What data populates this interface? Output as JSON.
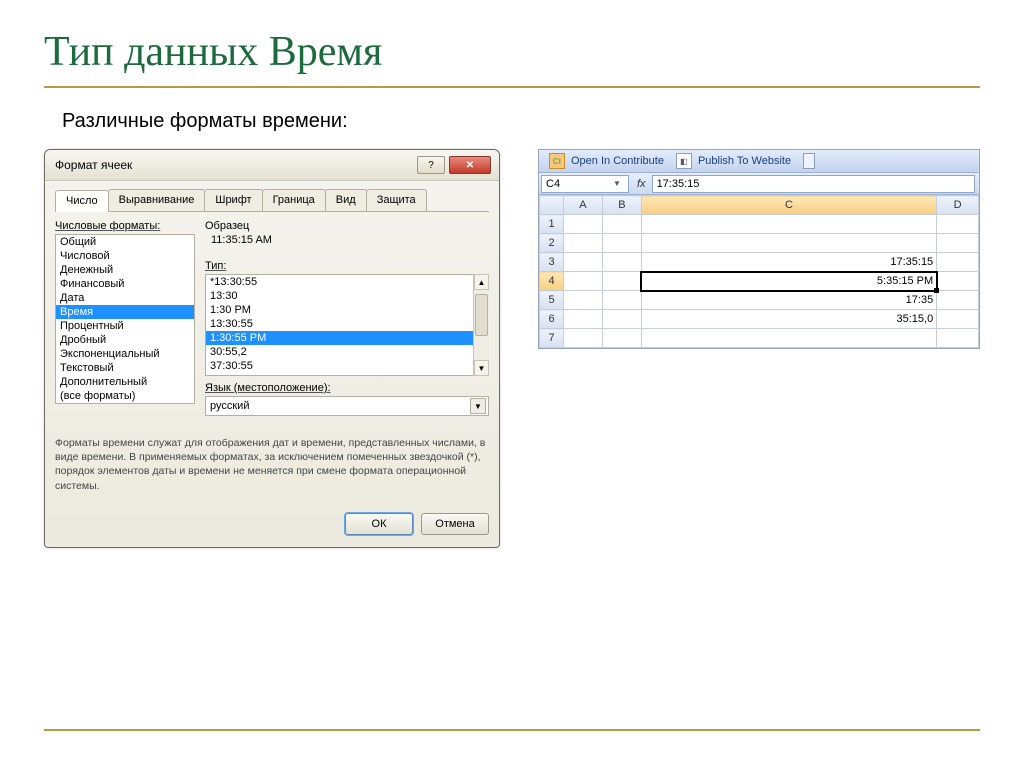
{
  "slide": {
    "title": "Тип данных Время",
    "subtitle": "Различные форматы времени:"
  },
  "dialog": {
    "caption": "Формат ячеек",
    "help_symbol": "?",
    "close_symbol": "✕",
    "tabs": [
      "Число",
      "Выравнивание",
      "Шрифт",
      "Граница",
      "Вид",
      "Защита"
    ],
    "formats_label": "Числовые форматы:",
    "format_items": [
      "Общий",
      "Числовой",
      "Денежный",
      "Финансовый",
      "Дата",
      "Время",
      "Процентный",
      "Дробный",
      "Экспоненциальный",
      "Текстовый",
      "Дополнительный",
      "(все форматы)"
    ],
    "format_selected_index": 5,
    "sample_label": "Образец",
    "sample_value": "11:35:15 AM",
    "type_label": "Тип:",
    "type_items": [
      "*13:30:55",
      "13:30",
      "1:30 PM",
      "13:30:55",
      "1:30:55 PM",
      "30:55,2",
      "37:30:55"
    ],
    "type_selected_index": 4,
    "locale_label": "Язык (местоположение):",
    "locale_value": "русский",
    "description": "Форматы времени служат для отображения дат и времени, представленных числами, в виде времени. В применяемых форматах, за исключением помеченных звездочкой (*), порядок элементов даты и времени не меняется при смене формата операционной системы.",
    "ok": "ОК",
    "cancel": "Отмена"
  },
  "excel": {
    "toolbar": {
      "open_label": "Open In Contribute",
      "publish_label": "Publish To Website",
      "ct_icon": "Ct"
    },
    "namebox": "C4",
    "fx_label": "fx",
    "formula_value": "17:35:15",
    "columns": [
      "A",
      "B",
      "C",
      "D"
    ],
    "rows": [
      "1",
      "2",
      "3",
      "4",
      "5",
      "6",
      "7"
    ],
    "cells": {
      "C3": "17:35:15",
      "C4": "5:35:15 PM",
      "C5": "17:35",
      "C6": "35:15,0"
    },
    "selected_col": "C",
    "selected_row": "4"
  }
}
